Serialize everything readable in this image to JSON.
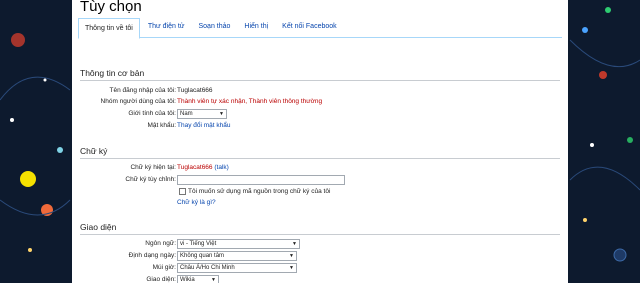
{
  "page_title": "Tùy chọn",
  "tabs": [
    "Thông tin về tôi",
    "Thư điện tử",
    "Soạn thảo",
    "Hiển thị",
    "Kết nối Facebook"
  ],
  "sections": {
    "basic": {
      "heading": "Thông tin cơ bản",
      "username_label": "Tên đăng nhập của tôi:",
      "username_value": "Tuglacat666",
      "groups_label": "Nhóm người dùng của tôi:",
      "groups_value": "Thành viên tự xác nhận, Thành viên thông thường",
      "gender_label": "Giới tính của tôi:",
      "gender_value": "Nam",
      "password_label": "Mật khẩu:",
      "password_link": "Thay đổi mật khẩu"
    },
    "signature": {
      "heading": "Chữ ký",
      "current_label": "Chữ ký hiện tại:",
      "current_user": "Tuglacat666",
      "current_talk": "(talk)",
      "custom_label": "Chữ ký tùy chỉnh:",
      "custom_value": "",
      "raw_checkbox_label": "Tôi muốn sử dụng mã nguồn trong chữ ký của tôi",
      "help_link": "Chữ ký là gì?"
    },
    "interface": {
      "heading": "Giao diện",
      "language_label": "Ngôn ngữ:",
      "language_value": "vi - Tiếng Việt",
      "date_label": "Định dạng ngày:",
      "date_value": "Không quan tâm",
      "timezone_label": "Múi giờ:",
      "timezone_value": "Châu Á/Ho Chi Minh",
      "skin_label": "Giao diện:",
      "skin_value": "Wikia"
    }
  },
  "colors": {
    "link": "#0645ad",
    "red_link": "#ba0000",
    "tab_border": "#a7d7f9",
    "background": "#0d1a2e"
  }
}
